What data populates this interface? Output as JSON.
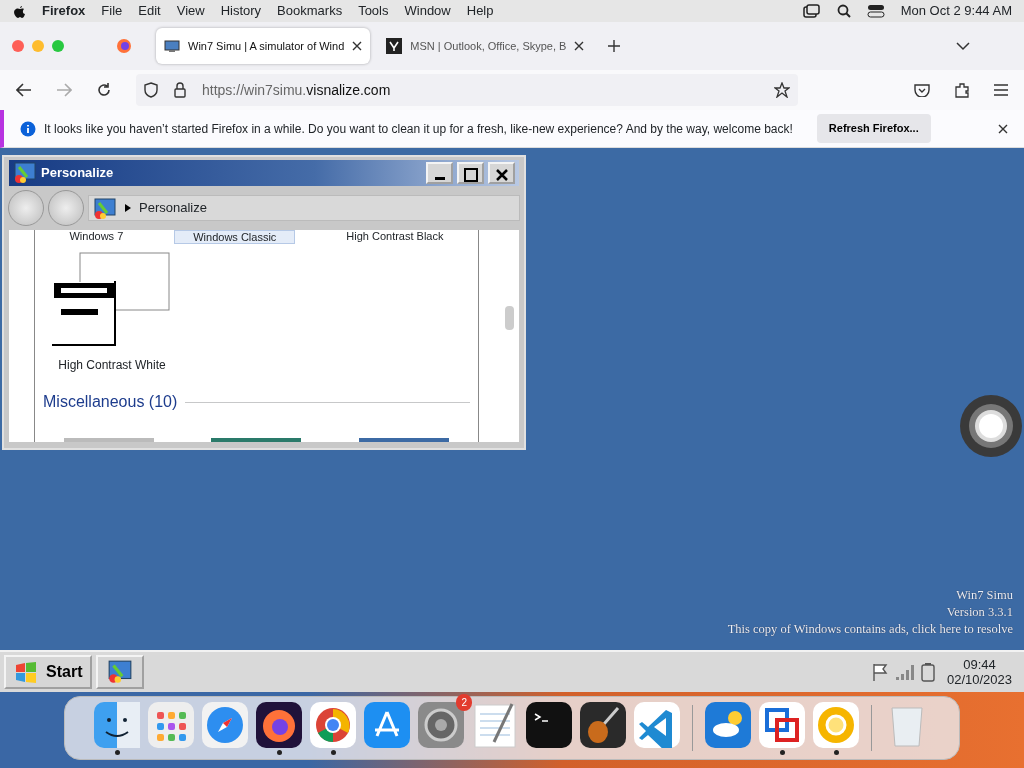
{
  "menu_bar": {
    "app": "Firefox",
    "items": [
      "File",
      "Edit",
      "View",
      "History",
      "Bookmarks",
      "Tools",
      "Window",
      "Help"
    ],
    "clock": "Mon Oct 2  9:44 AM"
  },
  "tabs": [
    {
      "title": "Win7 Simu | A simulator of Wind",
      "selected": true
    },
    {
      "title": "MSN | Outlook, Office, Skype, B",
      "selected": false
    }
  ],
  "url": {
    "prefix": "https://win7simu.",
    "domain": "visnalize.com"
  },
  "notification": {
    "text": "It looks like you haven’t started Firefox in a while. Do you want to clean it up for a fresh, like-new experience? And by the way, welcome back!",
    "button": "Refresh Firefox..."
  },
  "window": {
    "title": "Personalize",
    "breadcrumb": "Personalize",
    "themes_row": [
      {
        "label": "Windows 7",
        "selected": false
      },
      {
        "label": "Windows Classic",
        "selected": true
      },
      {
        "label": "High Contrast Black",
        "selected": false
      }
    ],
    "theme": "High Contrast White",
    "section": "Miscellaneous (10)"
  },
  "desktop_text": [
    "Win7 Simu",
    "Version 3.3.1",
    "This copy of Windows contains ads, click here to resolve"
  ],
  "taskbar": {
    "start": "Start",
    "time": "09:44",
    "date": "02/10/2023"
  },
  "dock": [
    {
      "kind": "finder",
      "running": true
    },
    {
      "kind": "launchpad",
      "running": false
    },
    {
      "kind": "safari",
      "running": false
    },
    {
      "kind": "firefox",
      "running": true
    },
    {
      "kind": "chrome",
      "running": true
    },
    {
      "kind": "appstore",
      "running": false
    },
    {
      "kind": "settings",
      "running": false,
      "badge": "2"
    },
    {
      "kind": "notes",
      "running": false
    },
    {
      "kind": "terminal",
      "running": false
    },
    {
      "kind": "guitar",
      "running": false
    },
    {
      "kind": "vscode",
      "running": false
    },
    {
      "kind": "weather",
      "running": false,
      "separator_before": true
    },
    {
      "kind": "vm",
      "running": true
    },
    {
      "kind": "canary",
      "running": true
    },
    {
      "kind": "trash",
      "running": false,
      "separator_before": true
    }
  ]
}
